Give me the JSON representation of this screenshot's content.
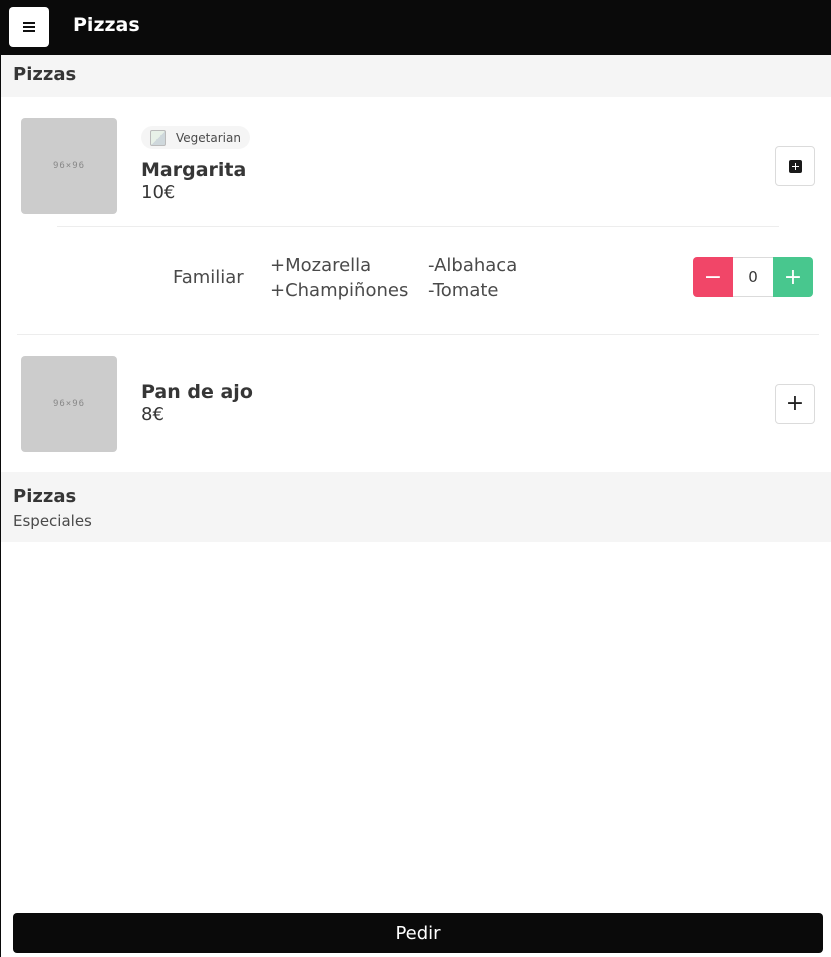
{
  "navbar": {
    "title": "Pizzas",
    "menu_icon": "hamburger-icon"
  },
  "sections": [
    {
      "title": "Pizzas"
    },
    {
      "title": "Pizzas",
      "subtitle": "Especiales"
    }
  ],
  "items": [
    {
      "name": "Margarita",
      "price": "10€",
      "thumb_label": "96×96",
      "tag": "Vegetarian",
      "add_icon": "plus-square-icon",
      "variant": {
        "size": "Familiar",
        "extras": [
          "+Mozarella",
          "+Champiñones"
        ],
        "removed": [
          "-Albahaca",
          "-Tomate"
        ],
        "quantity": "0",
        "minus_label": "−",
        "plus_label": "+"
      }
    },
    {
      "name": "Pan de ajo",
      "price": "8€",
      "thumb_label": "96×96",
      "add_label": "+"
    }
  ],
  "order_button": "Pedir",
  "colors": {
    "navbar": "#0a0a0a",
    "minus": "#f14668",
    "plus": "#48c78e",
    "section_bg": "#f5f5f5"
  }
}
